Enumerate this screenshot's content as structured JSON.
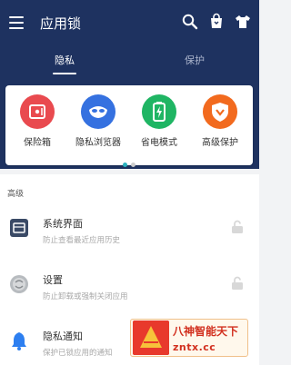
{
  "app": {
    "title": "应用锁"
  },
  "toolbar": {
    "icons": [
      "search-icon",
      "bag-icon",
      "shirt-icon"
    ]
  },
  "tabs": [
    {
      "label": "隐私",
      "active": true
    },
    {
      "label": "保护",
      "active": false
    }
  ],
  "features": [
    {
      "label": "保险箱",
      "icon": "safe-icon",
      "color": "#e94a4f"
    },
    {
      "label": "隐私浏览器",
      "icon": "mask-icon",
      "color": "#3571e0"
    },
    {
      "label": "省电模式",
      "icon": "battery-icon",
      "color": "#1fb563"
    },
    {
      "label": "高级保护",
      "icon": "shield-icon",
      "color": "#f26a1e"
    }
  ],
  "carousel": {
    "pages": 2,
    "current": 1
  },
  "section": {
    "title": "高级"
  },
  "rows": [
    {
      "title": "系统界面",
      "subtitle": "防止查看最近应用历史",
      "icon": "recent-apps-icon",
      "locked": false
    },
    {
      "title": "设置",
      "subtitle": "防止卸载或强制关闭应用",
      "icon": "settings-icon",
      "locked": false
    },
    {
      "title": "隐私通知",
      "subtitle": "保护已锁应用的通知",
      "icon": "bell-icon",
      "locked": false
    }
  ],
  "watermark": {
    "line1": "八神智能天下",
    "line2": "zntx.cc"
  },
  "colors": {
    "header": "#1e3260",
    "dot_active": "#2bb3c0",
    "dot_inactive": "#cccccc"
  }
}
